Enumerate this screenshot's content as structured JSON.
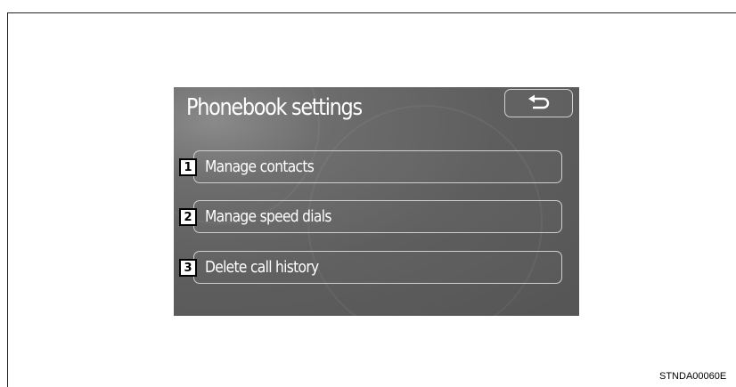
{
  "screen": {
    "title": "Phonebook settings",
    "back_icon": "return-arrow-icon",
    "menu": [
      {
        "number": "1",
        "label": "Manage contacts"
      },
      {
        "number": "2",
        "label": "Manage speed dials"
      },
      {
        "number": "3",
        "label": "Delete call history"
      }
    ]
  },
  "figure_code": "STNDA00060E",
  "colors": {
    "screen_bg": "#5e5e5e",
    "text": "#ffffff",
    "button_border": "#cfcfcf",
    "badge_bg": "#ffffff",
    "badge_border": "#000000"
  }
}
